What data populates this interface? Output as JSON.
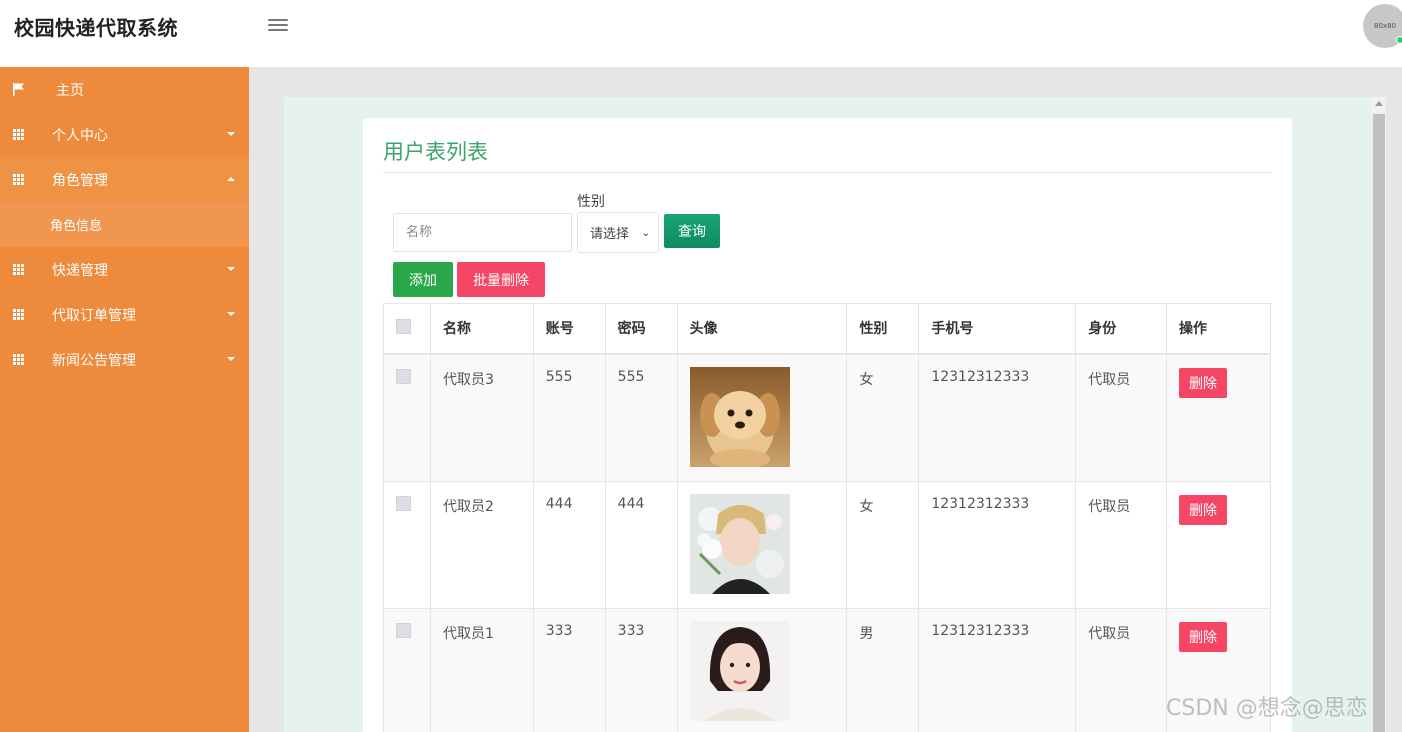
{
  "header": {
    "app_title": "校园快递代取系统",
    "avatar_text": "80x80"
  },
  "sidebar": {
    "items": [
      {
        "label": "主页",
        "icon": "flag-icon"
      },
      {
        "label": "个人中心",
        "icon": "grid-icon"
      },
      {
        "label": "角色管理",
        "icon": "grid-icon",
        "expanded": true,
        "children": [
          {
            "label": "角色信息"
          }
        ]
      },
      {
        "label": "快递管理",
        "icon": "grid-icon"
      },
      {
        "label": "代取订单管理",
        "icon": "grid-icon"
      },
      {
        "label": "新闻公告管理",
        "icon": "grid-icon"
      }
    ]
  },
  "main": {
    "title": "用户表列表",
    "search": {
      "name_placeholder": "名称",
      "gender_label": "性别",
      "gender_selected": "请选择",
      "query_label": "查询"
    },
    "actions": {
      "add_label": "添加",
      "batch_delete_label": "批量删除"
    },
    "table": {
      "headers": [
        "名称",
        "账号",
        "密码",
        "头像",
        "性别",
        "手机号",
        "身份",
        "操作"
      ],
      "rows": [
        {
          "name": "代取员3",
          "account": "555",
          "password": "555",
          "avatar": "puppy-photo",
          "gender": "女",
          "phone": "12312312333",
          "role": "代取员",
          "action": "删除"
        },
        {
          "name": "代取员2",
          "account": "444",
          "password": "444",
          "avatar": "young-man-with-flowers-photo",
          "gender": "女",
          "phone": "12312312333",
          "role": "代取员",
          "action": "删除"
        },
        {
          "name": "代取员1",
          "account": "333",
          "password": "333",
          "avatar": "woman-portrait-photo",
          "gender": "男",
          "phone": "12312312333",
          "role": "代取员",
          "action": "删除"
        }
      ]
    }
  },
  "watermark": "CSDN @想念@思恋",
  "colors": {
    "sidebar": "#ed8a3b",
    "title_green": "#3aa56a",
    "add_green": "#2aa748",
    "delete_red": "#f64665",
    "query_green": "#0e8c5e"
  }
}
